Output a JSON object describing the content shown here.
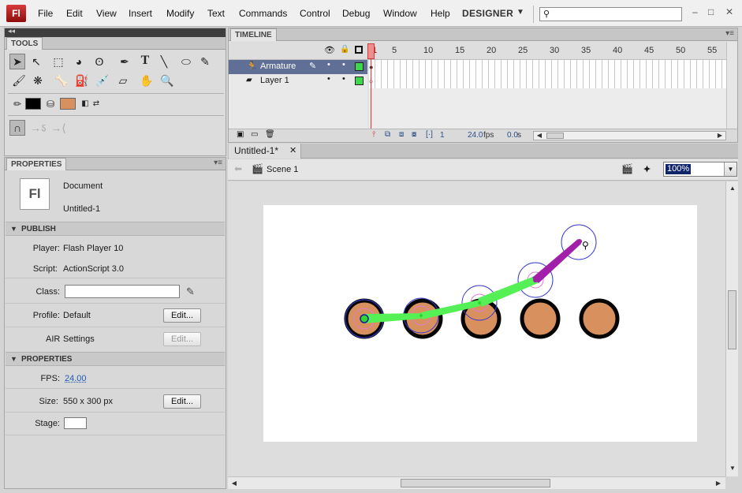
{
  "menubar": {
    "app_logo": "Fl",
    "items": [
      "File",
      "Edit",
      "View",
      "Insert",
      "Modify",
      "Text",
      "Commands",
      "Control",
      "Debug",
      "Window",
      "Help"
    ],
    "workspace": "DESIGNER",
    "search_placeholder": "",
    "window_controls": [
      "–",
      "□",
      "✕"
    ]
  },
  "tools_panel": {
    "tab": "TOOLS",
    "colors": {
      "stroke": "#000000",
      "fill": "#d8915e"
    }
  },
  "properties_panel": {
    "tab": "PROPERTIES",
    "doc_icon_text": "Fl",
    "doc_type": "Document",
    "doc_name": "Untitled-1",
    "publish": {
      "header": "PUBLISH",
      "player_label": "Player:",
      "player_value": "Flash Player 10",
      "script_label": "Script:",
      "script_value": "ActionScript 3.0",
      "class_label": "Class:",
      "class_value": "",
      "profile_label": "Profile:",
      "profile_value": "Default",
      "profile_button": "Edit...",
      "air_label": "AIR",
      "air_value": "Settings",
      "air_button": "Edit..."
    },
    "properties": {
      "header": "PROPERTIES",
      "fps_label": "FPS:",
      "fps_value": "24.00",
      "size_label": "Size:",
      "size_value": "550 x 300 px",
      "size_button": "Edit...",
      "stage_label": "Stage:",
      "stage_color": "#ffffff"
    }
  },
  "timeline": {
    "tab": "TIMELINE",
    "frame_numbers": [
      "1",
      "5",
      "10",
      "15",
      "20",
      "25",
      "30",
      "35",
      "40",
      "45",
      "50",
      "55"
    ],
    "layers": [
      {
        "name": "Armature",
        "selected": true
      },
      {
        "name": "Layer 1",
        "selected": false
      }
    ],
    "footer": {
      "current_frame": "1",
      "fps": "24.0",
      "fps_unit": "fps",
      "time": "0.0",
      "time_unit": "s"
    }
  },
  "document": {
    "tab_title": "Untitled-1*",
    "scene": "Scene 1",
    "zoom": "100%"
  }
}
